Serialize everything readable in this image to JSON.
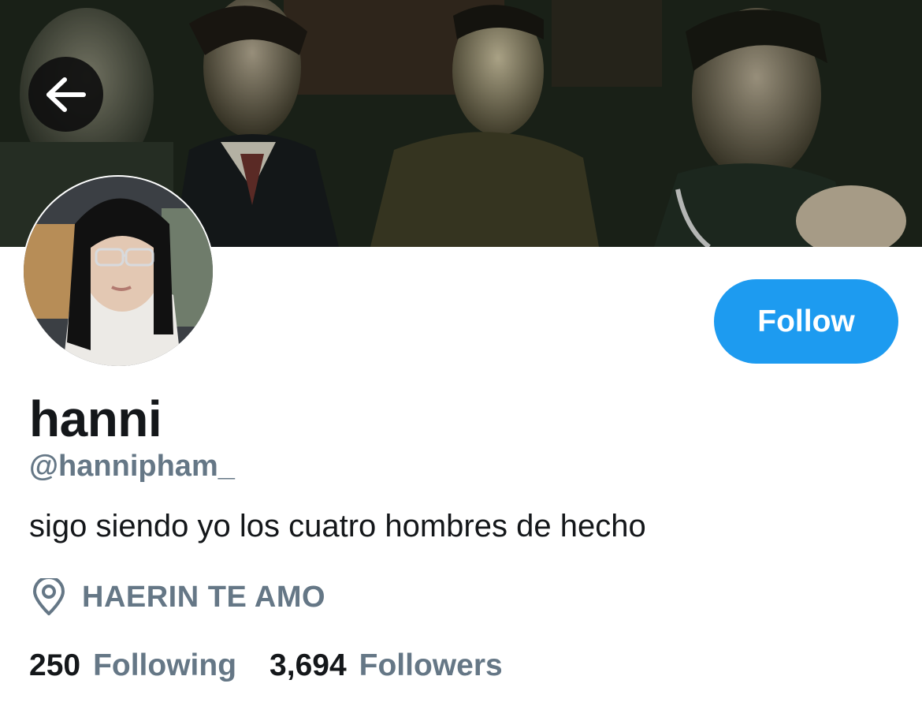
{
  "profile": {
    "display_name": "hanni",
    "handle": "@hannipham_",
    "bio": "sigo siendo yo los cuatro hombres de hecho",
    "location": "HAERIN TE AMO"
  },
  "stats": {
    "following_count": "250",
    "following_label": "Following",
    "followers_count": "3,694",
    "followers_label": "Followers"
  },
  "actions": {
    "follow_label": "Follow",
    "back_icon": "arrow-left-icon"
  },
  "icons": {
    "location": "location-pin-icon"
  },
  "colors": {
    "accent": "#1d9bf0",
    "text_primary": "#14171a",
    "text_secondary": "#657786"
  }
}
